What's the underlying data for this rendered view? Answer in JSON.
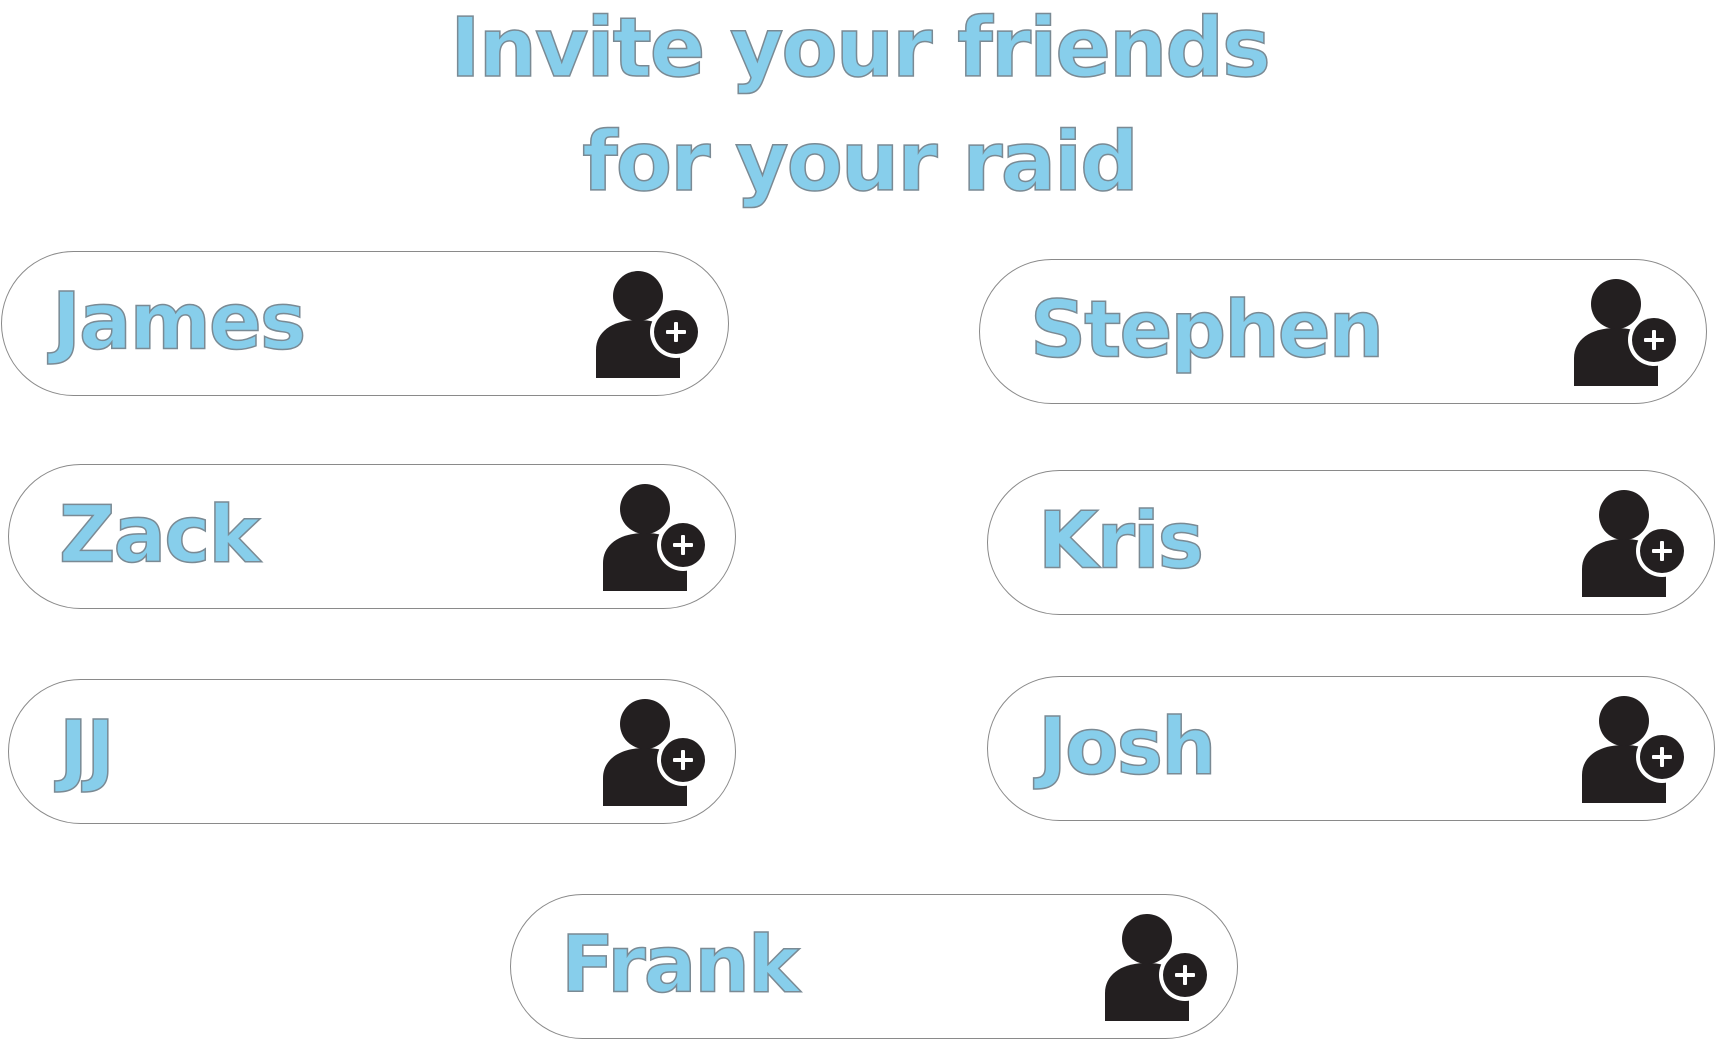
{
  "header": {
    "title_line_1": "Invite your friends",
    "title_line_2": "for your raid"
  },
  "friends": [
    {
      "name": "James",
      "action_icon": "add-user-icon"
    },
    {
      "name": "Stephen",
      "action_icon": "add-user-icon"
    },
    {
      "name": "Zack",
      "action_icon": "add-user-icon"
    },
    {
      "name": "Kris",
      "action_icon": "add-user-icon"
    },
    {
      "name": "JJ",
      "action_icon": "add-user-icon"
    },
    {
      "name": "Josh",
      "action_icon": "add-user-icon"
    },
    {
      "name": "Frank",
      "action_icon": "add-user-icon"
    }
  ],
  "colors": {
    "name_text": "#87CEEB",
    "text_outline": "#7a8a94",
    "pill_border": "#8a8a8a",
    "icon": "#231f20",
    "background": "#ffffff"
  }
}
